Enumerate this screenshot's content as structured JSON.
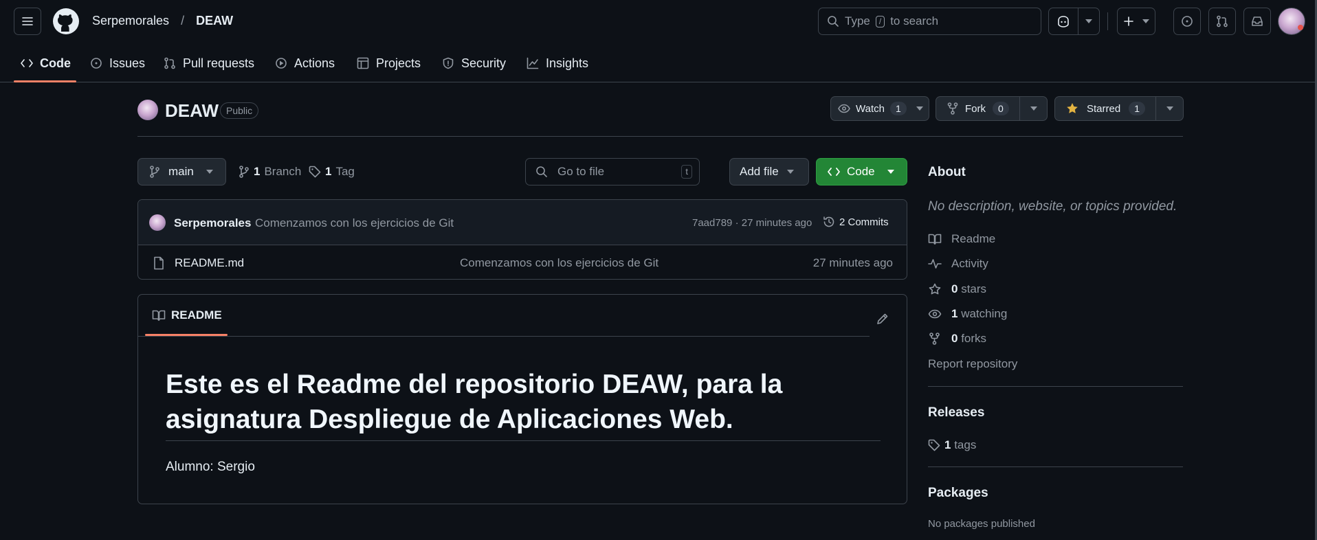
{
  "header": {
    "owner": "Serpemorales",
    "slash": "/",
    "repo": "DEAW",
    "search_pre": "Type",
    "search_key": "/",
    "search_post": "to search"
  },
  "tabs": [
    {
      "label": "Code",
      "icon": "code-icon"
    },
    {
      "label": "Issues",
      "icon": "issue-icon"
    },
    {
      "label": "Pull requests",
      "icon": "pull-request-icon"
    },
    {
      "label": "Actions",
      "icon": "play-icon"
    },
    {
      "label": "Projects",
      "icon": "table-icon"
    },
    {
      "label": "Security",
      "icon": "shield-icon"
    },
    {
      "label": "Insights",
      "icon": "graph-icon"
    }
  ],
  "repo_header": {
    "name": "DEAW",
    "visibility": "Public",
    "watch_label": "Watch",
    "watch_count": "1",
    "fork_label": "Fork",
    "fork_count": "0",
    "star_label": "Starred",
    "star_count": "1"
  },
  "toolbar": {
    "branch": "main",
    "branch_count": "1",
    "branch_label": "Branch",
    "tag_count": "1",
    "tag_label": "Tag",
    "goto_placeholder": "Go to file",
    "goto_key": "t",
    "add_file": "Add file",
    "code": "Code"
  },
  "commit": {
    "author": "Serpemorales",
    "message": "Comenzamos con los ejercicios de Git",
    "meta": "7aad789 · 27 minutes ago",
    "commits_label": "2 Commits"
  },
  "files": [
    {
      "name": "README.md",
      "message": "Comenzamos con los ejercicios de Git",
      "time": "27 minutes ago"
    }
  ],
  "readme": {
    "tab_label": "README",
    "heading_line1": "Este es el Readme del repositorio DEAW, para la",
    "heading_line2": "asignatura Despliegue de Aplicaciones Web.",
    "body": "Alumno: Sergio"
  },
  "about": {
    "title": "About",
    "description": "No description, website, or topics provided.",
    "readme": "Readme",
    "activity": "Activity",
    "stars_count": "0",
    "stars_label": "stars",
    "watching_count": "1",
    "watching_label": "watching",
    "forks_count": "0",
    "forks_label": "forks",
    "report": "Report repository"
  },
  "releases": {
    "title": "Releases",
    "tags_count": "1",
    "tags_label": "tags"
  },
  "packages": {
    "title": "Packages",
    "empty": "No packages published"
  },
  "colors": {
    "background": "#0d1117",
    "accent_green": "#238636",
    "tab_underline": "#f78166",
    "star_yellow": "#e3b341"
  }
}
